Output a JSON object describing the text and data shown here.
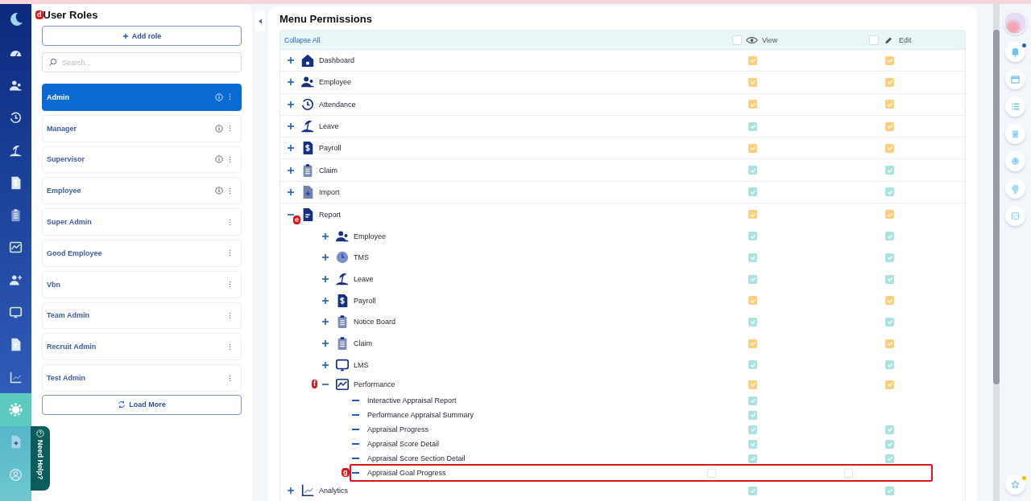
{
  "nav": [
    {
      "selected": false
    },
    {
      "selected": false
    },
    {
      "selected": false
    },
    {
      "selected": false
    },
    {
      "selected": false
    },
    {
      "selected": false
    },
    {
      "selected": false
    },
    {
      "selected": false
    },
    {
      "selected": false
    },
    {
      "selected": false
    },
    {
      "selected": false
    },
    {
      "selected": true
    },
    {
      "selected": false
    },
    {
      "selected": false
    }
  ],
  "roles_panel": {
    "marker": "d",
    "title": "User Roles",
    "add_button": "Add role",
    "search": {
      "placeholder": "Search..."
    },
    "roles": [
      {
        "name": "Admin",
        "selected": true,
        "info": true
      },
      {
        "name": "Manager",
        "selected": false,
        "info": true
      },
      {
        "name": "Supervisor",
        "selected": false,
        "info": true
      },
      {
        "name": "Employee",
        "selected": false,
        "info": true
      },
      {
        "name": "Super Admin",
        "selected": false,
        "info": false
      },
      {
        "name": "Good Employee",
        "selected": false,
        "info": false
      },
      {
        "name": "Vbn",
        "selected": false,
        "info": false
      },
      {
        "name": "Team Admin",
        "selected": false,
        "info": false
      },
      {
        "name": "Recruit Admin",
        "selected": false,
        "info": false
      },
      {
        "name": "Test Admin",
        "selected": false,
        "info": false
      }
    ],
    "load_more": "Load More"
  },
  "help_tab": "Need Help?",
  "permissions": {
    "title": "Menu Permissions",
    "collapse_all": "Collapse All",
    "columns": [
      {
        "label": "View",
        "checked": false
      },
      {
        "label": "Edit",
        "checked": false
      }
    ],
    "items": [
      {
        "label": "Dashboard",
        "expanded": false,
        "view": {
          "checked": true,
          "color": "#fdd07e"
        },
        "edit": {
          "checked": true,
          "color": "#fdd07e"
        }
      },
      {
        "label": "Employee",
        "expanded": false,
        "view": {
          "checked": true,
          "color": "#fdd07e"
        },
        "edit": {
          "checked": true,
          "color": "#fdd07e"
        }
      },
      {
        "label": "Attendance",
        "expanded": false,
        "view": {
          "checked": true,
          "color": "#fdd07e"
        },
        "edit": {
          "checked": true,
          "color": "#fdd07e"
        }
      },
      {
        "label": "Leave",
        "expanded": false,
        "view": {
          "checked": true,
          "color": "#a9e2de"
        },
        "edit": {
          "checked": true,
          "color": "#fdd07e"
        }
      },
      {
        "label": "Payroll",
        "expanded": false,
        "view": {
          "checked": true,
          "color": "#fdd07e"
        },
        "edit": {
          "checked": true,
          "color": "#fdd07e"
        }
      },
      {
        "label": "Claim",
        "expanded": false,
        "view": {
          "checked": true,
          "color": "#a9e2de"
        },
        "edit": {
          "checked": true,
          "color": "#a9e2de"
        }
      },
      {
        "label": "Import",
        "expanded": false,
        "view": {
          "checked": true,
          "color": "#a9e2de"
        },
        "edit": {
          "checked": true,
          "color": "#a9e2de"
        }
      },
      {
        "label": "Report",
        "expanded": true,
        "marker": "e",
        "view": {
          "checked": true,
          "color": "#fdd07e"
        },
        "edit": {
          "checked": true,
          "color": "#fdd07e"
        },
        "children": [
          {
            "label": "Employee",
            "expanded": false,
            "view": {
              "checked": true,
              "color": "#a9e2de"
            },
            "edit": {
              "checked": true,
              "color": "#a9e2de"
            }
          },
          {
            "label": "TMS",
            "expanded": false,
            "view": {
              "checked": true,
              "color": "#a9e2de"
            },
            "edit": {
              "checked": true,
              "color": "#a9e2de"
            }
          },
          {
            "label": "Leave",
            "expanded": false,
            "view": {
              "checked": true,
              "color": "#a9e2de"
            },
            "edit": {
              "checked": true,
              "color": "#a9e2de"
            }
          },
          {
            "label": "Payroll",
            "expanded": false,
            "view": {
              "checked": true,
              "color": "#fdd07e"
            },
            "edit": {
              "checked": true,
              "color": "#fdd07e"
            }
          },
          {
            "label": "Notice Board",
            "expanded": false,
            "view": {
              "checked": true,
              "color": "#a9e2de"
            },
            "edit": {
              "checked": true,
              "color": "#a9e2de"
            }
          },
          {
            "label": "Claim",
            "expanded": false,
            "view": {
              "checked": true,
              "color": "#fdd07e"
            },
            "edit": {
              "checked": true,
              "color": "#fdd07e"
            }
          },
          {
            "label": "LMS",
            "expanded": false,
            "view": {
              "checked": true,
              "color": "#a9e2de"
            },
            "edit": {
              "checked": true,
              "color": "#a9e2de"
            }
          },
          {
            "label": "Performance",
            "expanded": true,
            "marker": "f",
            "view": {
              "checked": true,
              "color": "#fdd07e"
            },
            "edit": {
              "checked": true,
              "color": "#fdd07e"
            },
            "children": [
              {
                "label": "Interactive Appraisal Report",
                "highlighted": false,
                "view": {
                  "checked": true,
                  "color": "#a9e2de"
                }
              },
              {
                "label": "Performance Appraisal Summary",
                "highlighted": false,
                "view": {
                  "checked": true,
                  "color": "#a9e2de"
                }
              },
              {
                "label": "Appraisal Progress",
                "highlighted": false,
                "view": {
                  "checked": true,
                  "color": "#a9e2de"
                },
                "edit": {
                  "checked": true,
                  "color": "#a9e2de"
                }
              },
              {
                "label": "Appraisal Score Detail",
                "highlighted": false,
                "view": {
                  "checked": true,
                  "color": "#a9e2de"
                },
                "edit": {
                  "checked": true,
                  "color": "#a9e2de"
                }
              },
              {
                "label": "Appraisal Score Section Detail",
                "highlighted": false,
                "view": {
                  "checked": true,
                  "color": "#a9e2de"
                },
                "edit": {
                  "checked": true,
                  "color": "#a9e2de"
                }
              },
              {
                "label": "Appraisal Goal Progress",
                "highlighted": true,
                "marker": "g",
                "view": {
                  "checked": false
                },
                "edit": {
                  "checked": false
                }
              }
            ]
          }
        ]
      },
      {
        "label": "Analytics",
        "expanded": false,
        "view": {
          "checked": true,
          "color": "#a9e2de"
        },
        "edit": {
          "checked": true,
          "color": "#a9e2de"
        }
      }
    ]
  }
}
